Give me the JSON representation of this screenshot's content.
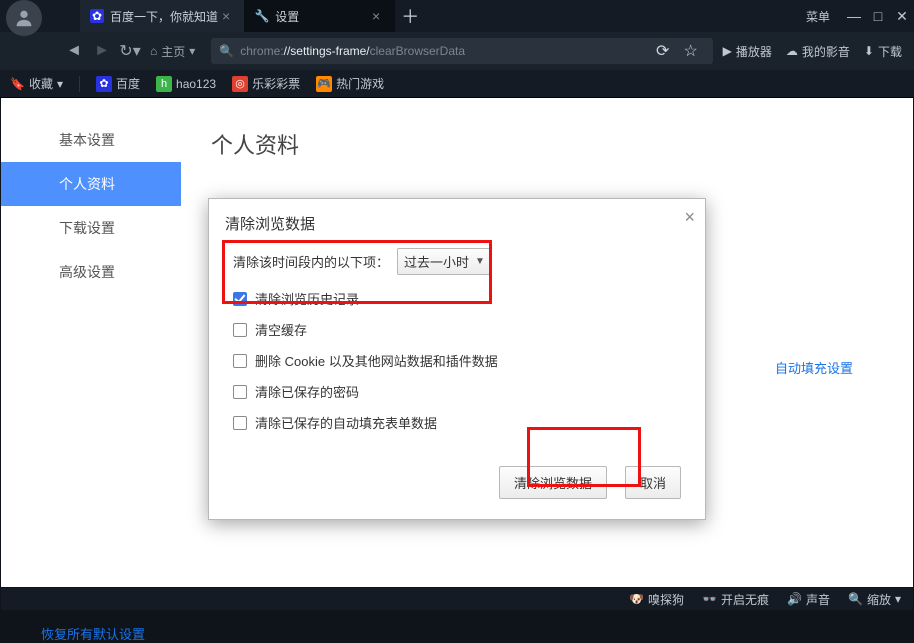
{
  "window": {
    "menu_label": "菜单"
  },
  "tabs": [
    {
      "title": "百度一下，你就知道",
      "fav_bg": "#2932e1",
      "active": false
    },
    {
      "title": "设置",
      "fav_bg": "#222",
      "active": true
    }
  ],
  "nav": {
    "home_label": "主页",
    "url_scheme": "chrome:",
    "url_path1": "//settings-frame/",
    "url_path2": "clearBrowserData",
    "right": {
      "player": "播放器",
      "media": "我的影音",
      "download": "下载"
    }
  },
  "bookmarks": {
    "fav_label": "收藏",
    "items": [
      {
        "label": "百度",
        "bg": "#2932e1"
      },
      {
        "label": "hao123",
        "bg": "#3db44a"
      },
      {
        "label": "乐彩彩票",
        "bg": "#e04030"
      },
      {
        "label": "热门游戏",
        "bg": "#ff8a00"
      }
    ]
  },
  "sidebar": {
    "items": [
      {
        "label": "基本设置"
      },
      {
        "label": "个人资料"
      },
      {
        "label": "下载设置"
      },
      {
        "label": "高级设置"
      }
    ],
    "active_index": 1,
    "reset": "恢复所有默认设置"
  },
  "content": {
    "title": "个人资料",
    "autofill_link": "自动填充设置"
  },
  "dialog": {
    "title": "清除浏览数据",
    "time_label": "清除该时间段内的以下项：",
    "time_value": "过去一小时",
    "options": [
      {
        "label": "清除浏览历史记录",
        "checked": true
      },
      {
        "label": "清空缓存",
        "checked": false
      },
      {
        "label": "删除 Cookie 以及其他网站数据和插件数据",
        "checked": false
      },
      {
        "label": "清除已保存的密码",
        "checked": false
      },
      {
        "label": "清除已保存的自动填充表单数据",
        "checked": false
      }
    ],
    "primary": "清除浏览数据",
    "cancel": "取消"
  },
  "status": {
    "sniffer": "嗅探狗",
    "incognito": "开启无痕",
    "sound": "声音",
    "zoom": "缩放"
  }
}
